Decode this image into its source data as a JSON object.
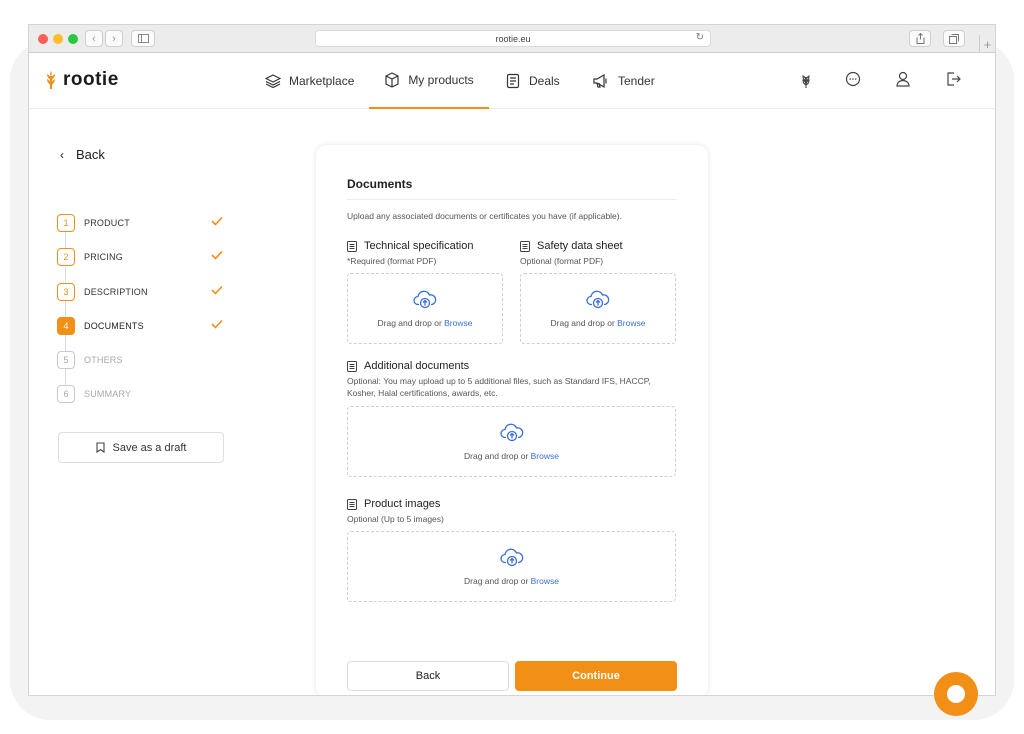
{
  "browser": {
    "url": "rootie.eu"
  },
  "app": {
    "logo_text": "rootie",
    "brand_color": "#f18f16",
    "link_color": "#3a6fd8"
  },
  "nav": {
    "items": [
      {
        "label": "Marketplace",
        "icon": "layers-icon",
        "active": false
      },
      {
        "label": "My products",
        "icon": "box-icon",
        "active": true
      },
      {
        "label": "Deals",
        "icon": "document-icon",
        "active": false
      },
      {
        "label": "Tender",
        "icon": "megaphone-icon",
        "active": false
      }
    ],
    "right_icons": [
      "wheat-icon",
      "chat-icon",
      "user-icon",
      "logout-icon"
    ]
  },
  "sidebar": {
    "back_label": "Back",
    "steps": [
      {
        "num": "1",
        "label": "PRODUCT",
        "state": "done"
      },
      {
        "num": "2",
        "label": "PRICING",
        "state": "done"
      },
      {
        "num": "3",
        "label": "DESCRIPTION",
        "state": "done"
      },
      {
        "num": "4",
        "label": "DOCUMENTS",
        "state": "current"
      },
      {
        "num": "5",
        "label": "OTHERS",
        "state": "pending"
      },
      {
        "num": "6",
        "label": "SUMMARY",
        "state": "pending"
      }
    ],
    "draft_label": "Save as a draft"
  },
  "card": {
    "title": "Documents",
    "description": "Upload any associated documents or certificates you have (if applicable).",
    "tech_spec": {
      "title": "Technical specification",
      "sub": "*Required (format PDF)"
    },
    "safety": {
      "title": "Safety data sheet",
      "sub": "Optional (format PDF)"
    },
    "additional": {
      "title": "Additional documents",
      "sub": "Optional: You may upload up to 5 additional files, such as Standard IFS, HACCP, Kosher, Halal certifications, awards, etc."
    },
    "images": {
      "title": "Product images",
      "sub": "Optional (Up to 5 images)"
    },
    "drop_text": "Drag and drop or ",
    "browse_text": "Browse",
    "back_button": "Back",
    "continue_button": "Continue"
  }
}
